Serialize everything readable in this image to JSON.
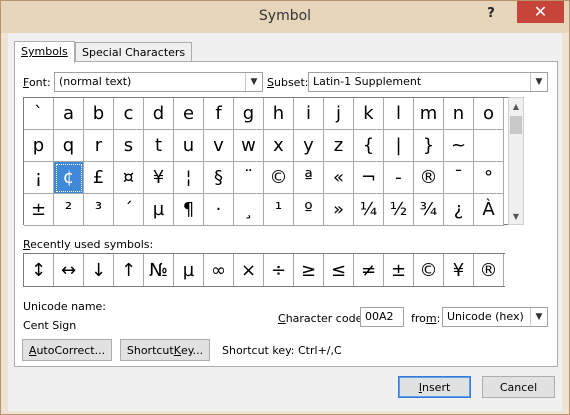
{
  "window": {
    "title": "Symbol",
    "help": "?",
    "close": "✕"
  },
  "tabs": [
    {
      "label": "Symbols",
      "active": true
    },
    {
      "label": "Special Characters",
      "active": false
    }
  ],
  "font": {
    "label_pre": "",
    "label_key": "F",
    "label_post": "ont:",
    "value": "(normal text)"
  },
  "subset": {
    "label_pre": "S",
    "label_key": "u",
    "label_post": "bset:",
    "value": "Latin-1 Supplement"
  },
  "symbols": [
    [
      "`",
      "a",
      "b",
      "c",
      "d",
      "e",
      "f",
      "g",
      "h",
      "i",
      "j",
      "k",
      "l",
      "m",
      "n",
      "o"
    ],
    [
      "p",
      "q",
      "r",
      "s",
      "t",
      "u",
      "v",
      "w",
      "x",
      "y",
      "z",
      "{",
      "|",
      "}",
      "~",
      ""
    ],
    [
      "¡",
      "¢",
      "£",
      "¤",
      "¥",
      "¦",
      "§",
      "¨",
      "©",
      "ª",
      "«",
      "¬",
      "-",
      "®",
      "¯",
      "°"
    ],
    [
      "±",
      "²",
      "³",
      "´",
      "µ",
      "¶",
      "·",
      "¸",
      "¹",
      "º",
      "»",
      "¼",
      "½",
      "¾",
      "¿",
      "À"
    ]
  ],
  "selected": {
    "row": 2,
    "col": 1
  },
  "recent": {
    "label_key": "R",
    "label_rest": "ecently used symbols:",
    "items": [
      "↕",
      "↔",
      "↓",
      "↑",
      "№",
      "µ",
      "∞",
      "×",
      "÷",
      "≥",
      "≤",
      "≠",
      "±",
      "©",
      "¥",
      "®"
    ]
  },
  "unicode": {
    "label": "Unicode name:",
    "name": "Cent Sign"
  },
  "char_code": {
    "label_pre": "",
    "label_key": "C",
    "label_post": "haracter code:",
    "value": "00A2"
  },
  "from": {
    "label_pre": "fro",
    "label_key": "m",
    "label_post": ":",
    "value": "Unicode (hex)"
  },
  "buttons": {
    "autocorrect": {
      "key": "A",
      "rest": "utoCorrect..."
    },
    "shortcut": {
      "pre": "Shortcut ",
      "key": "K",
      "post": "ey..."
    },
    "insert": {
      "key": "I",
      "rest": "nsert"
    },
    "cancel": "Cancel"
  },
  "shortcut_text": "Shortcut key: Ctrl+/,C"
}
